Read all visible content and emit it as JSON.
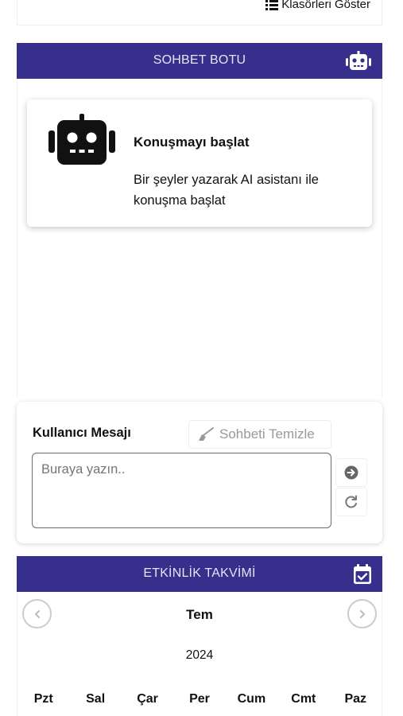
{
  "top": {
    "show_folders_label": "Klasörleri Göster"
  },
  "chatbot": {
    "header_title": "SOHBET BOTU",
    "start_title": "Konuşmayı başlat",
    "start_description": "Bir şeyler yazarak AI asistanı ile konuşma başlat"
  },
  "message": {
    "label": "Kullanıcı Mesajı",
    "clear_label": "Sohbeti Temizle",
    "placeholder": "Buraya yazın.."
  },
  "calendar": {
    "header_title": "ETKİNLİK TAKVİMİ",
    "month": "Tem",
    "year": "2024",
    "weekdays": [
      "Pzt",
      "Sal",
      "Çar",
      "Per",
      "Cum",
      "Cmt",
      "Paz"
    ]
  },
  "colors": {
    "header_bg": "#362f8c",
    "text": "#111111",
    "muted": "#999999"
  },
  "icons": [
    "list-icon",
    "robot-icon",
    "broom-icon",
    "arrow-right-circle-icon",
    "refresh-icon",
    "calendar-check-icon",
    "chevron-left-icon",
    "chevron-right-icon"
  ]
}
